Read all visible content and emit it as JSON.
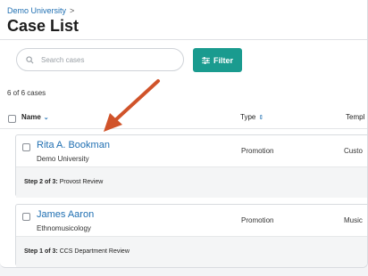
{
  "breadcrumb": {
    "root": "Demo University",
    "separator": ">"
  },
  "page": {
    "title": "Case List"
  },
  "toolbar": {
    "search_placeholder": "Search cases",
    "filter_label": "Filter"
  },
  "summary": {
    "count_text": "6 of 6 cases"
  },
  "table": {
    "columns": [
      {
        "label": "Name",
        "sort_icon": "chevron-down"
      },
      {
        "label": "Type",
        "sort_icon": "sort-updown"
      },
      {
        "label": "Templ"
      }
    ]
  },
  "cases": [
    {
      "name": "Rita A. Bookman",
      "unit": "Demo University",
      "type": "Promotion",
      "template": "Custo",
      "step_label": "Step 2 of 3:",
      "step_name": "Provost Review"
    },
    {
      "name": "James Aaron",
      "unit": "Ethnomusicology",
      "type": "Promotion",
      "template": "Music",
      "step_label": "Step 1 of 3:",
      "step_name": "CCS Department Review"
    }
  ],
  "colors": {
    "accent": "#1a9b8f",
    "link": "#1f6fb2",
    "annotation_arrow": "#d0532a"
  },
  "icons": {
    "search": "search-icon",
    "filter": "sliders-icon",
    "arrow": "annotation-arrow"
  }
}
